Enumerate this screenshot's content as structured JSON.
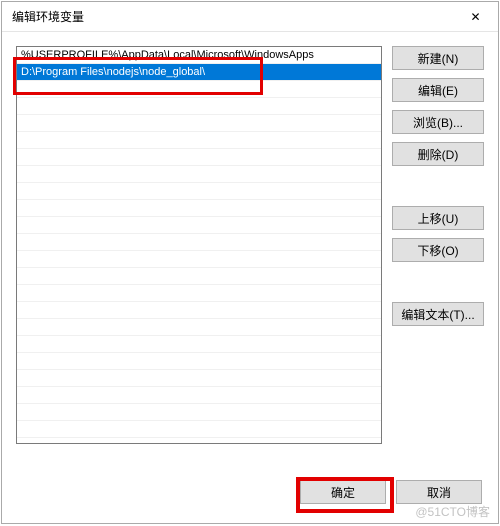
{
  "window": {
    "title": "编辑环境变量",
    "close_glyph": "✕"
  },
  "list": {
    "items": [
      "%USERPROFILE%\\AppData\\Local\\Microsoft\\WindowsApps",
      "D:\\Program Files\\nodejs\\node_global\\"
    ],
    "selected_index": 1
  },
  "buttons": {
    "new": "新建(N)",
    "edit": "编辑(E)",
    "browse": "浏览(B)...",
    "delete": "删除(D)",
    "move_up": "上移(U)",
    "move_down": "下移(O)",
    "edit_text": "编辑文本(T)...",
    "ok": "确定",
    "cancel": "取消"
  },
  "watermark": "@51CTO博客"
}
